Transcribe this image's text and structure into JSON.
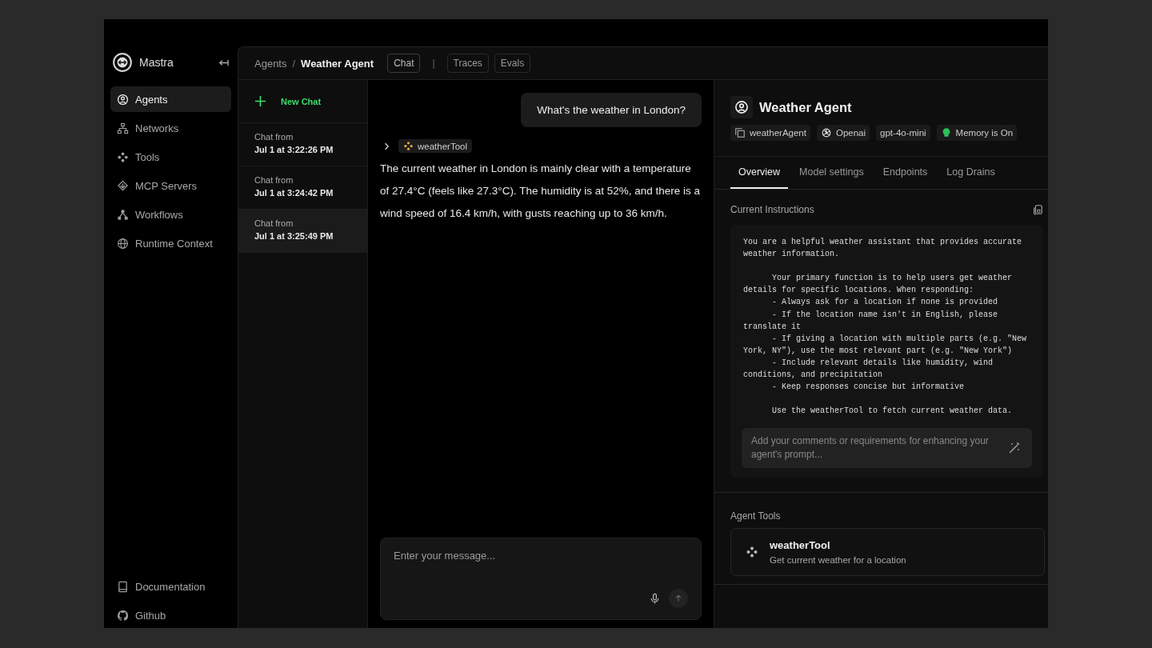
{
  "sidebar": {
    "brand": "Mastra",
    "items": [
      {
        "label": "Agents",
        "selected": true
      },
      {
        "label": "Networks",
        "selected": false
      },
      {
        "label": "Tools",
        "selected": false
      },
      {
        "label": "MCP Servers",
        "selected": false
      },
      {
        "label": "Workflows",
        "selected": false
      },
      {
        "label": "Runtime Context",
        "selected": false
      }
    ],
    "footer": [
      {
        "label": "Documentation"
      },
      {
        "label": "Github"
      }
    ]
  },
  "header": {
    "breadcrumb": [
      "Agents",
      "Weather Agent"
    ],
    "separator": "/",
    "tabs": [
      {
        "label": "Chat",
        "selected": true
      },
      {
        "label": "Traces",
        "selected": false
      },
      {
        "label": "Evals",
        "selected": false
      }
    ],
    "divider": "|"
  },
  "chats": {
    "new_chat": "New Chat",
    "items": [
      {
        "title": "Chat from",
        "time": "Jul 1 at 3:22:26 PM",
        "selected": false
      },
      {
        "title": "Chat from",
        "time": "Jul 1 at 3:24:42 PM",
        "selected": false
      },
      {
        "title": "Chat from",
        "time": "Jul 1 at 3:25:49 PM",
        "selected": true
      }
    ]
  },
  "conversation": {
    "user_message": "What's the weather in London?",
    "tool_call": "weatherTool",
    "reply": "The current weather in London is mainly clear with a temperature of 27.4°C (feels like 27.3°C). The humidity is at 52%, and there is a wind speed of 16.4 km/h, with gusts reaching up to 36 km/h.",
    "input": {
      "placeholder": "Enter your message..."
    }
  },
  "agent": {
    "name": "Weather Agent",
    "badges": [
      {
        "label": "weatherAgent"
      },
      {
        "label": "Openai"
      },
      {
        "label": "gpt-4o-mini"
      },
      {
        "label": "Memory is On"
      }
    ],
    "tabs": [
      {
        "label": "Overview",
        "selected": true
      },
      {
        "label": "Model settings",
        "selected": false
      },
      {
        "label": "Endpoints",
        "selected": false
      },
      {
        "label": "Log Drains",
        "selected": false
      }
    ],
    "instructions_title": "Current Instructions",
    "instructions": "You are a helpful weather assistant that provides accurate weather information.\n\n      Your primary function is to help users get weather details for specific locations. When responding:\n      - Always ask for a location if none is provided\n      - If the location name isn't in English, please translate it\n      - If giving a location with multiple parts (e.g. \"New York, NY\"), use the most relevant part (e.g. \"New York\")\n      - Include relevant details like humidity, wind conditions, and precipitation\n      - Keep responses concise but informative\n\n      Use the weatherTool to fetch current weather data.",
    "enhance": {
      "placeholder": "Add your comments or requirements for enhancing your agent's prompt..."
    },
    "tools_title": "Agent Tools",
    "tools": [
      {
        "name": "weatherTool",
        "description": "Get current weather for a location"
      }
    ]
  }
}
